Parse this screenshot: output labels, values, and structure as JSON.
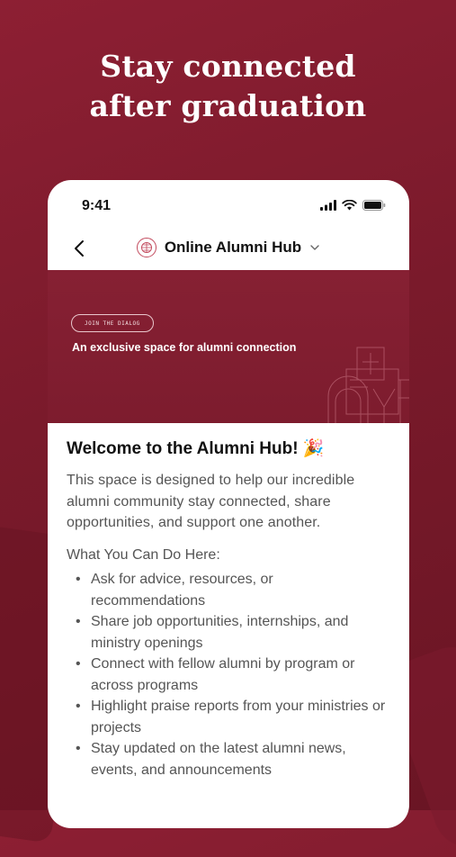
{
  "headline": {
    "line1": "Stay connected",
    "line2": "after graduation"
  },
  "status_bar": {
    "time": "9:41",
    "icons": [
      "signal-icon",
      "wifi-icon",
      "battery-icon"
    ]
  },
  "nav": {
    "back_icon": "chevron-left-icon",
    "title": "Online Alumni Hub",
    "dropdown_icon": "chevron-down-icon"
  },
  "banner": {
    "pill": "JOIN THE DIALOG",
    "subtitle": "An exclusive space for alumni connection"
  },
  "post": {
    "title": "Welcome to the Alumni Hub! 🎉",
    "intro": "This space is designed to help our incredible alumni community stay connected, share opportunities, and support one another.",
    "section_title": "What You Can Do Here:",
    "items": [
      "Ask for advice, resources, or recommendations",
      "Share job opportunities, internships, and ministry openings",
      "Connect with fellow alumni by program or across programs",
      "Highlight praise reports from your ministries or projects",
      "Stay updated on the latest alumni news, events, and announcements"
    ]
  },
  "colors": {
    "background": "#7e1c2f",
    "banner": "#842033",
    "accent": "#c24a5d"
  }
}
